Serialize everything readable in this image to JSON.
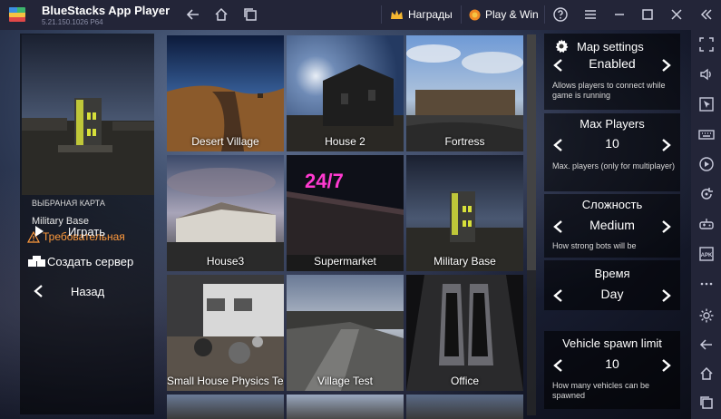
{
  "titlebar": {
    "app_title": "BlueStacks App Player",
    "app_version": "5.21.150.1026 P64",
    "rewards_label": "Награды",
    "playwin_label": "Play & Win"
  },
  "game": {
    "left": {
      "selected_map_heading": "ВЫБРАНАЯ КАРТА",
      "selected_map_name": "Military Base",
      "required_label": "Требовательная",
      "play_label": "Играть",
      "create_server_label": "Создать сервер",
      "back_label": "Назад"
    },
    "maps": [
      {
        "label": "Desert Village"
      },
      {
        "label": "House 2"
      },
      {
        "label": "Fortress"
      },
      {
        "label": "House3"
      },
      {
        "label": "Supermarket"
      },
      {
        "label": "Military Base"
      },
      {
        "label": "Small House Physics Test"
      },
      {
        "label": "Village Test"
      },
      {
        "label": "Office"
      }
    ],
    "settings": {
      "header_title": "Map settings",
      "server": {
        "value": "Enabled",
        "desc": "Allows players to connect while game is running"
      },
      "max_players": {
        "title": "Max Players",
        "value": "10",
        "desc": "Max. players (only for multiplayer)"
      },
      "difficulty": {
        "title": "Сложность",
        "value": "Medium",
        "desc": "How strong bots will be"
      },
      "time": {
        "title": "Время",
        "value": "Day"
      },
      "vehicles": {
        "title": "Vehicle spawn limit",
        "value": "10",
        "desc": "How many vehicles can be spawned"
      }
    }
  },
  "colors": {
    "required": "#ff9a3c",
    "titlebar_bg": "#232538"
  }
}
